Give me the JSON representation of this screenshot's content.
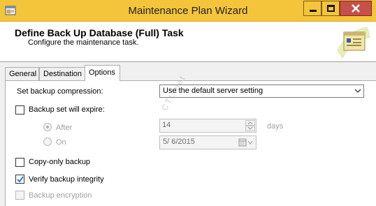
{
  "window": {
    "title": "Maintenance Plan Wizard"
  },
  "header": {
    "title": "Define Back Up Database (Full) Task",
    "subtitle": "Configure the maintenance task."
  },
  "tabs": [
    {
      "label": "General"
    },
    {
      "label": "Destination"
    },
    {
      "label": "Options",
      "selected": true
    }
  ],
  "options": {
    "compression_label": "Set backup compression:",
    "compression_value": "Use the default server setting",
    "expire": {
      "label": "Backup set will expire:",
      "checked": false,
      "after_label": "After",
      "after_selected": true,
      "after_value": "14",
      "days_label": "days",
      "on_label": "On",
      "on_value": "5/ 6/2015"
    },
    "copy_only": {
      "label": "Copy-only backup",
      "checked": false
    },
    "verify": {
      "label": "Verify backup integrity",
      "checked": true
    },
    "encryption": {
      "label": "Backup encryption",
      "checked": false,
      "enabled": false
    }
  },
  "watermark": "CTL.net",
  "colors": {
    "titlebar": "#f4c43a",
    "close_button": "#c7504a",
    "check_mark": "#1a6fc4"
  }
}
